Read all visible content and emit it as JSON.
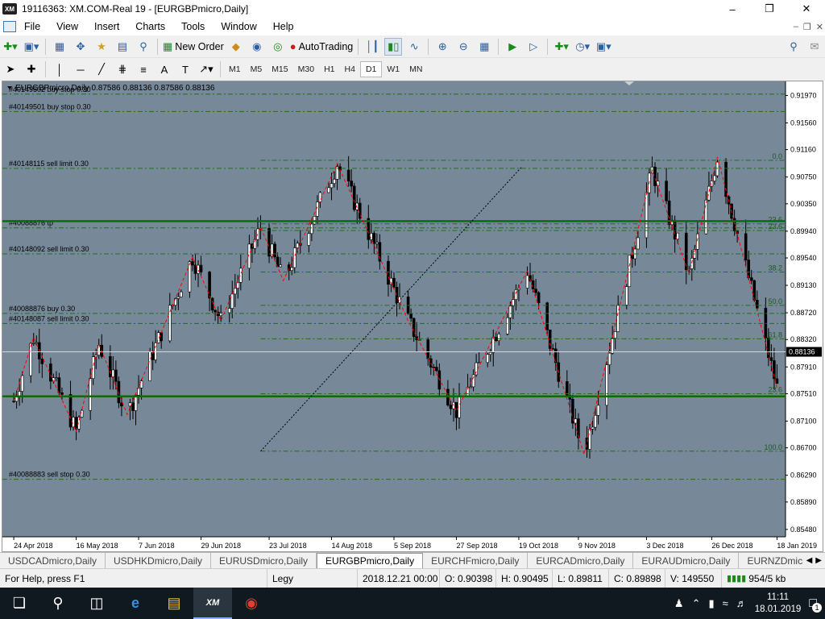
{
  "window": {
    "title": "19116363: XM.COM-Real 19 - [EURGBPmicro,Daily]",
    "logo": "XM"
  },
  "menu": [
    "File",
    "View",
    "Insert",
    "Charts",
    "Tools",
    "Window",
    "Help"
  ],
  "toolbar": {
    "new_order": "New Order",
    "autotrading": "AutoTrading"
  },
  "timeframes": [
    "M1",
    "M5",
    "M15",
    "M30",
    "H1",
    "H4",
    "D1",
    "W1",
    "MN"
  ],
  "active_timeframe": "D1",
  "chart_data": {
    "type": "candlestick",
    "header": "EURGBPmicro,Daily  0.87586 0.88136 0.87586 0.88136",
    "ylim": [
      0.8537,
      0.9218
    ],
    "y_ticks": [
      "0.91970",
      "0.91560",
      "0.91160",
      "0.90750",
      "0.90350",
      "0.89940",
      "0.89540",
      "0.89130",
      "0.88720",
      "0.88320",
      "0.87910",
      "0.87510",
      "0.87100",
      "0.86700",
      "0.86290",
      "0.85890",
      "0.85480"
    ],
    "x_ticks": [
      "24 Apr 2018",
      "16 May 2018",
      "7 Jun 2018",
      "29 Jun 2018",
      "23 Jul 2018",
      "14 Aug 2018",
      "5 Sep 2018",
      "27 Sep 2018",
      "19 Oct 2018",
      "9 Nov 2018",
      "3 Dec 2018",
      "26 Dec 2018",
      "18 Jan 2019"
    ],
    "current_price": "0.88136",
    "order_lines": [
      {
        "label": "#40149502 buy stop 0.30",
        "price": 0.9199
      },
      {
        "label": "#40149501 buy stop 0.30",
        "price": 0.9173
      },
      {
        "label": "#40148115 sell limit 0.30",
        "price": 0.9088
      },
      {
        "label": "#40088876 tp",
        "price": 0.8999
      },
      {
        "label": "#40148092 sell limit 0.30",
        "price": 0.896
      },
      {
        "label": "#40088876 buy 0.30",
        "price": 0.8871
      },
      {
        "label": "#40148087 sell limit 0.30",
        "price": 0.8856
      },
      {
        "label": "#40088883 sell stop 0.30",
        "price": 0.8623
      }
    ],
    "fib_levels": [
      {
        "label": "0.0",
        "price": 0.91
      },
      {
        "label": "23.6",
        "price": 0.9005
      },
      {
        "label": "23.6",
        "price": 0.8995
      },
      {
        "label": "38.2",
        "price": 0.8933
      },
      {
        "label": "50.0",
        "price": 0.8883
      },
      {
        "label": "61.8",
        "price": 0.8833
      },
      {
        "label": "23.6",
        "price": 0.8751
      },
      {
        "label": "100.0",
        "price": 0.8665
      }
    ],
    "horizontal_lines": [
      0.9009,
      0.8747
    ],
    "zigzag": [
      {
        "x": "24 Apr 2018",
        "y": 0.874
      },
      {
        "x": "1 May 2018",
        "y": 0.8835
      },
      {
        "x": "16 May 2018",
        "y": 0.8695
      },
      {
        "x": "24 May 2018",
        "y": 0.8825
      },
      {
        "x": "3 Jun 2018",
        "y": 0.872
      },
      {
        "x": "26 Jun 2018",
        "y": 0.8955
      },
      {
        "x": "6 Jul 2018",
        "y": 0.886
      },
      {
        "x": "20 Jul 2018",
        "y": 0.9
      },
      {
        "x": "28 Jul 2018",
        "y": 0.892
      },
      {
        "x": "16 Aug 2018",
        "y": 0.9095
      },
      {
        "x": "10 Sep 2018",
        "y": 0.886
      },
      {
        "x": "27 Sep 2018",
        "y": 0.8725
      },
      {
        "x": "22 Oct 2018",
        "y": 0.8935
      },
      {
        "x": "11 Nov 2018",
        "y": 0.866
      },
      {
        "x": "5 Dec 2018",
        "y": 0.9085
      },
      {
        "x": "18 Dec 2018",
        "y": 0.893
      },
      {
        "x": "28 Dec 2018",
        "y": 0.9105
      },
      {
        "x": "18 Jan 2019",
        "y": 0.876
      }
    ],
    "trendline": [
      {
        "x": "20 Jul 2018",
        "y": 0.8665
      },
      {
        "x": "20 Oct 2018",
        "y": 0.909
      }
    ]
  },
  "chart_tabs": [
    "USDCADmicro,Daily",
    "USDHKDmicro,Daily",
    "EURUSDmicro,Daily",
    "EURGBPmicro,Daily",
    "EURCHFmicro,Daily",
    "EURCADmicro,Daily",
    "EURAUDmicro,Daily",
    "EURNZDmicro,"
  ],
  "active_tab": "EURGBPmicro,Daily",
  "status": {
    "help": "For Help, press F1",
    "profile": "Legy",
    "datetime": "2018.12.21 00:00",
    "open": "O: 0.90398",
    "high": "H: 0.90495",
    "low": "L: 0.89811",
    "close": "C: 0.89898",
    "volume": "V: 149550",
    "traffic": "954/5 kb"
  },
  "taskbar": {
    "time": "11:11",
    "date": "18.01.2019",
    "notifications": "1"
  },
  "colors": {
    "chart_bg": "#778899",
    "candle": "#000000",
    "grid_line": "#1e6e1e",
    "zigzag": "#ff0000",
    "axis_text": "#000000"
  }
}
